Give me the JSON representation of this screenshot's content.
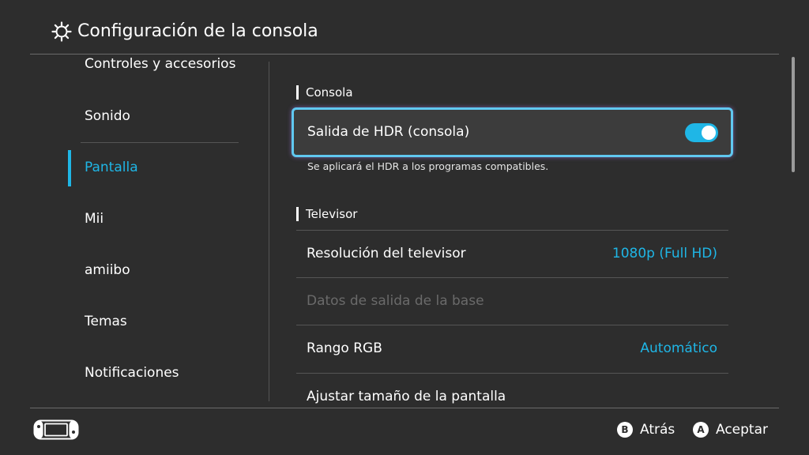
{
  "header": {
    "title": "Configuración de la consola",
    "icon": "gear-icon"
  },
  "sidebar": {
    "items": [
      {
        "label": "Controles y accesorios",
        "active": false
      },
      {
        "label": "Sonido",
        "active": false
      },
      {
        "label": "Pantalla",
        "active": true
      },
      {
        "label": "Mii",
        "active": false
      },
      {
        "label": "amiibo",
        "active": false
      },
      {
        "label": "Temas",
        "active": false
      },
      {
        "label": "Notificaciones",
        "active": false
      }
    ]
  },
  "main": {
    "sections": [
      {
        "title": "Consola",
        "items": [
          {
            "label": "Salida de HDR (consola)",
            "control": "toggle",
            "toggle_on": true,
            "focused": true,
            "description": "Se aplicará el HDR a los programas compatibles."
          }
        ]
      },
      {
        "title": "Televisor",
        "items": [
          {
            "label": "Resolución del televisor",
            "value": "1080p (Full HD)",
            "disabled": false
          },
          {
            "label": "Datos de salida de la base",
            "value": "",
            "disabled": true
          },
          {
            "label": "Rango RGB",
            "value": "Automático",
            "disabled": false
          },
          {
            "label": "Ajustar tamaño de la pantalla",
            "value": "",
            "disabled": false
          }
        ]
      }
    ]
  },
  "footer": {
    "console_icon": "handheld-console-icon",
    "actions": [
      {
        "button": "B",
        "label": "Atrás"
      },
      {
        "button": "A",
        "label": "Aceptar"
      }
    ]
  },
  "colors": {
    "background": "#2d2d2d",
    "accent": "#1fb6e6",
    "divider": "#555555",
    "disabled_text": "#6a6a6a"
  }
}
